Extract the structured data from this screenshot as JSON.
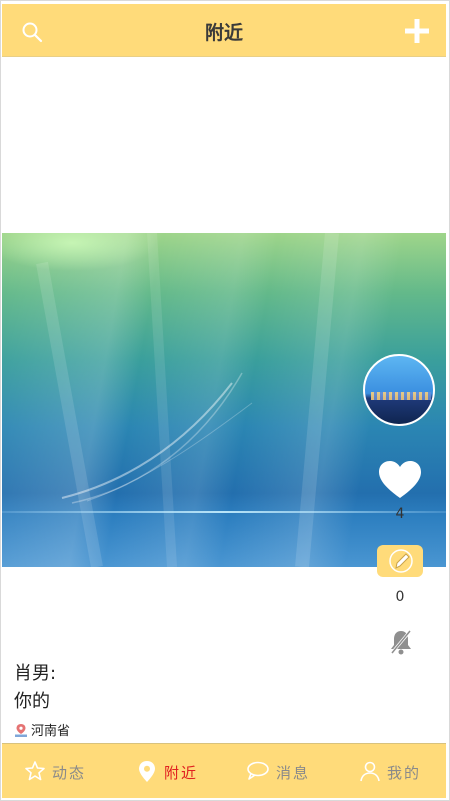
{
  "header": {
    "title": "附近"
  },
  "post": {
    "like_count": "4",
    "comment_count": "0",
    "author": "肖男:",
    "caption": "你的",
    "location": "河南省"
  },
  "tabs": [
    {
      "label": "动态",
      "icon": "star-icon",
      "active": false
    },
    {
      "label": "附近",
      "icon": "location-pin-icon",
      "active": true
    },
    {
      "label": "消息",
      "icon": "chat-bubble-icon",
      "active": false
    },
    {
      "label": "我的",
      "icon": "user-icon",
      "active": false
    }
  ],
  "colors": {
    "accent": "#ffdb7a",
    "active_tab": "#e02020",
    "inactive_tab": "#8a8a8a"
  }
}
